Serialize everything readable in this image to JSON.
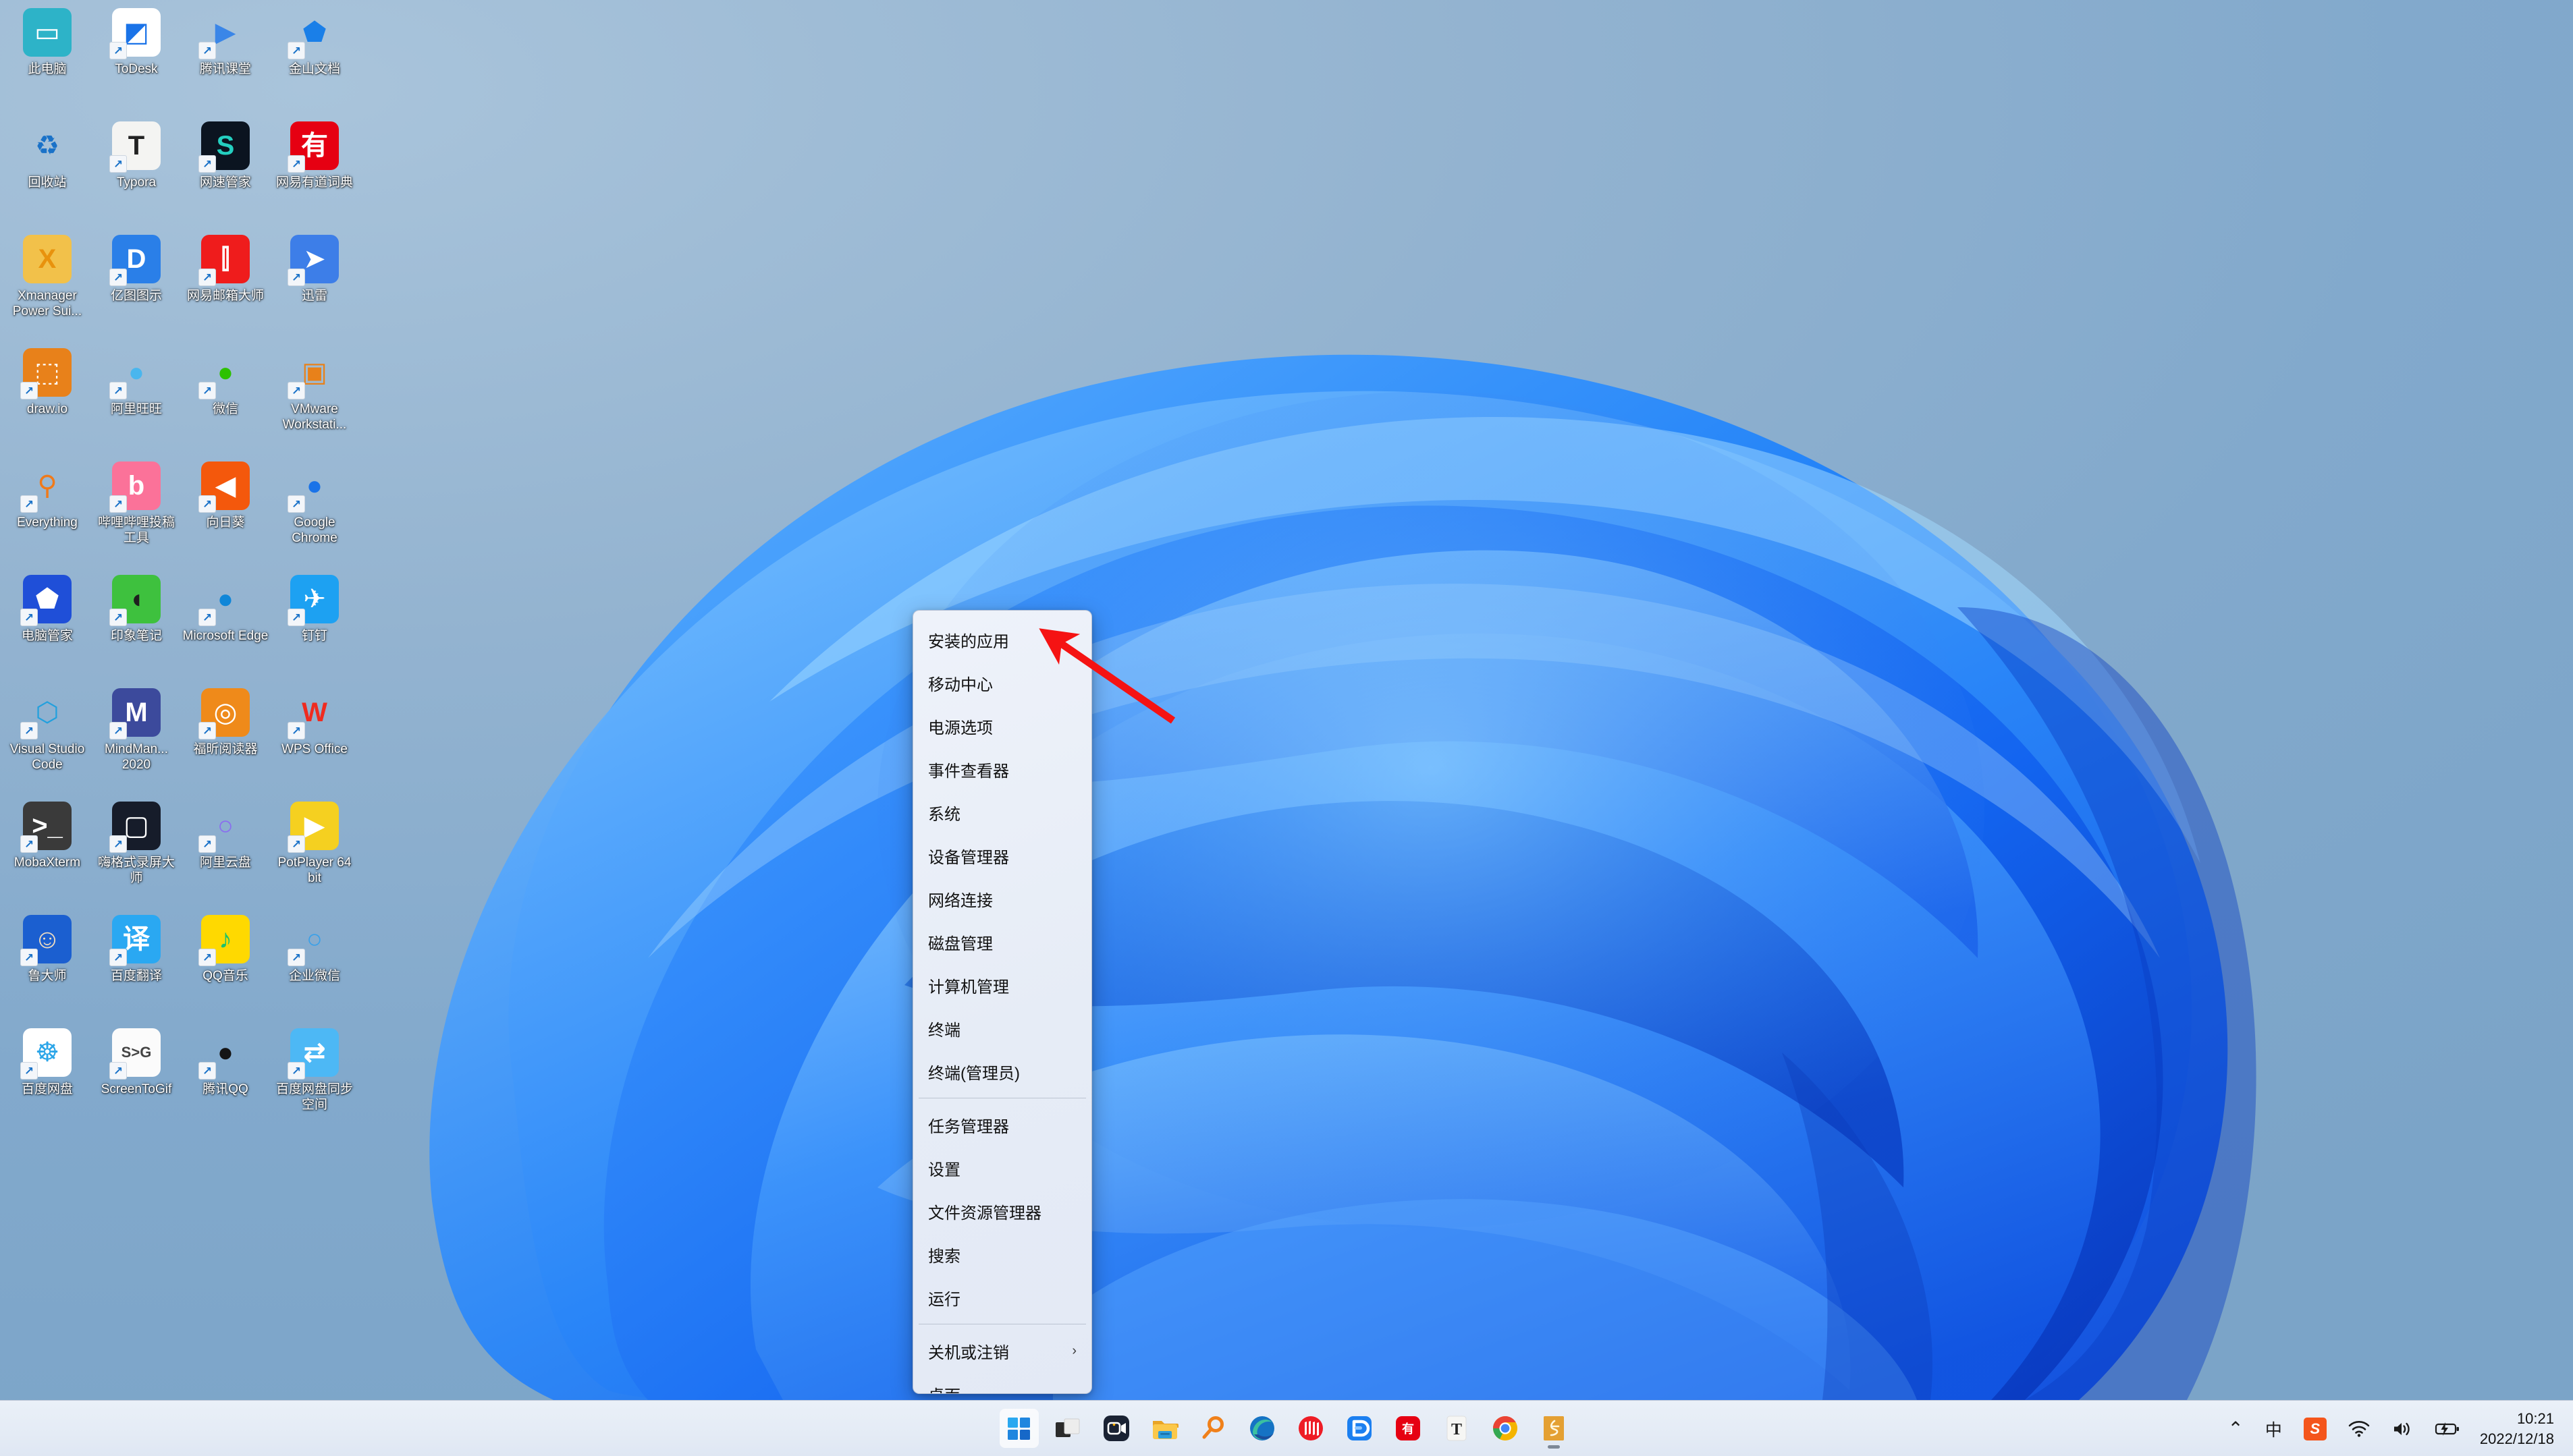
{
  "desktop": {
    "background_color": "#82aacd",
    "icons": [
      {
        "label": "此电脑",
        "icon": "computer-icon",
        "shortcut": false,
        "bg": "#2db3c8",
        "fg": "#ffffff",
        "glyph": "▭"
      },
      {
        "label": "ToDesk",
        "icon": "todesk-icon",
        "shortcut": true,
        "bg": "#ffffff",
        "fg": "#1a73e8",
        "glyph": "◩"
      },
      {
        "label": "腾讯课堂",
        "icon": "tencent-classroom-icon",
        "shortcut": true,
        "bg": "transparent",
        "fg": "#3a86e8",
        "glyph": "▶"
      },
      {
        "label": "金山文档",
        "icon": "kingsoft-docs-icon",
        "shortcut": true,
        "bg": "transparent",
        "fg": "#1a7fe8",
        "glyph": "⬟"
      },
      {
        "label": "回收站",
        "icon": "recycle-bin-icon",
        "shortcut": false,
        "bg": "transparent",
        "fg": "#1a72c8",
        "glyph": "♻"
      },
      {
        "label": "Typora",
        "icon": "typora-icon",
        "shortcut": true,
        "bg": "#f4f4f2",
        "fg": "#222222",
        "glyph": "T"
      },
      {
        "label": "网速管家",
        "icon": "netspeed-manager-icon",
        "shortcut": true,
        "bg": "#0b1420",
        "fg": "#24cfc0",
        "glyph": "S"
      },
      {
        "label": "网易有道词典",
        "icon": "youdao-dict-icon",
        "shortcut": true,
        "bg": "#e60012",
        "fg": "#ffffff",
        "glyph": "有"
      },
      {
        "label": "Xmanager Power Sui...",
        "icon": "xmanager-folder-icon",
        "shortcut": false,
        "bg": "#f2c14a",
        "fg": "#e8920d",
        "glyph": "X"
      },
      {
        "label": "亿图图示",
        "icon": "edraw-icon",
        "shortcut": true,
        "bg": "#2a7fe8",
        "fg": "#ffffff",
        "glyph": "D"
      },
      {
        "label": "网易邮箱大师",
        "icon": "netease-mail-icon",
        "shortcut": true,
        "bg": "#ef1c1c",
        "fg": "#ffffff",
        "glyph": "⫿"
      },
      {
        "label": "迅雷",
        "icon": "thunder-xunlei-icon",
        "shortcut": true,
        "bg": "#3d7ee8",
        "fg": "#ffffff",
        "glyph": "➤"
      },
      {
        "label": "draw.io",
        "icon": "drawio-icon",
        "shortcut": true,
        "bg": "#e8811a",
        "fg": "#ffffff",
        "glyph": "⬚"
      },
      {
        "label": "阿里旺旺",
        "icon": "aliwangwang-icon",
        "shortcut": true,
        "bg": "transparent",
        "fg": "#49b6ee",
        "glyph": "●"
      },
      {
        "label": "微信",
        "icon": "wechat-icon",
        "shortcut": true,
        "bg": "transparent",
        "fg": "#2dc100",
        "glyph": "●"
      },
      {
        "label": "VMware Workstati...",
        "icon": "vmware-icon",
        "shortcut": true,
        "bg": "transparent",
        "fg": "#e8811a",
        "glyph": "▣"
      },
      {
        "label": "Everything",
        "icon": "everything-search-icon",
        "shortcut": true,
        "bg": "transparent",
        "fg": "#f07a1a",
        "glyph": "⚲"
      },
      {
        "label": "哔哩哔哩投稿工具",
        "icon": "bilibili-upload-icon",
        "shortcut": true,
        "bg": "#fb7299",
        "fg": "#ffffff",
        "glyph": "b"
      },
      {
        "label": "向日葵",
        "icon": "sunlogin-icon",
        "shortcut": true,
        "bg": "#f4580c",
        "fg": "#ffffff",
        "glyph": "◀"
      },
      {
        "label": "Google Chrome",
        "icon": "chrome-icon",
        "shortcut": true,
        "bg": "transparent",
        "fg": "#1a73e8",
        "glyph": "●"
      },
      {
        "label": "电脑管家",
        "icon": "tencent-pc-manager-icon",
        "shortcut": true,
        "bg": "#1f4fd8",
        "fg": "#ffffff",
        "glyph": "⬟"
      },
      {
        "label": "印象笔记",
        "icon": "evernote-icon",
        "shortcut": true,
        "bg": "#3ec13e",
        "fg": "#1f1f1f",
        "glyph": "◖"
      },
      {
        "label": "Microsoft Edge",
        "icon": "edge-icon",
        "shortcut": true,
        "bg": "transparent",
        "fg": "#0f86d8",
        "glyph": "●"
      },
      {
        "label": "钉钉",
        "icon": "dingtalk-icon",
        "shortcut": true,
        "bg": "#1da1f2",
        "fg": "#ffffff",
        "glyph": "✈"
      },
      {
        "label": "Visual Studio Code",
        "icon": "vscode-icon",
        "shortcut": true,
        "bg": "transparent",
        "fg": "#22a0dd",
        "glyph": "⬡"
      },
      {
        "label": "MindMan... 2020",
        "icon": "mindmanager-icon",
        "shortcut": true,
        "bg": "#3c4a9c",
        "fg": "#ffffff",
        "glyph": "M"
      },
      {
        "label": "福昕阅读器",
        "icon": "foxit-reader-icon",
        "shortcut": true,
        "bg": "#ef8a1a",
        "fg": "#ffffff",
        "glyph": "◎"
      },
      {
        "label": "WPS Office",
        "icon": "wps-office-icon",
        "shortcut": true,
        "bg": "transparent",
        "fg": "#ef2b20",
        "glyph": "W"
      },
      {
        "label": "MobaXterm",
        "icon": "mobaxterm-icon",
        "shortcut": true,
        "bg": "#3a3a3a",
        "fg": "#ffffff",
        "glyph": ">_"
      },
      {
        "label": "嗨格式录屏大师",
        "icon": "haigeshi-recorder-icon",
        "shortcut": true,
        "bg": "#161c2a",
        "fg": "#ffffff",
        "glyph": "▢"
      },
      {
        "label": "阿里云盘",
        "icon": "aliyun-drive-icon",
        "shortcut": true,
        "bg": "transparent",
        "fg": "#8a6cf0",
        "glyph": "○"
      },
      {
        "label": "PotPlayer 64 bit",
        "icon": "potplayer-icon",
        "shortcut": true,
        "bg": "#f5d020",
        "fg": "#ffffff",
        "glyph": "▶"
      },
      {
        "label": "鲁大师",
        "icon": "ludashi-icon",
        "shortcut": true,
        "bg": "#1b5fd0",
        "fg": "#f0ddc0",
        "glyph": "☺"
      },
      {
        "label": "百度翻译",
        "icon": "baidu-translate-icon",
        "shortcut": true,
        "bg": "#2aa8f2",
        "fg": "#ffffff",
        "glyph": "译"
      },
      {
        "label": "QQ音乐",
        "icon": "qq-music-icon",
        "shortcut": true,
        "bg": "#ffd900",
        "fg": "#1ec26a",
        "glyph": "♪"
      },
      {
        "label": "企业微信",
        "icon": "wecom-icon",
        "shortcut": true,
        "bg": "transparent",
        "fg": "#3aa0e8",
        "glyph": "○"
      },
      {
        "label": "百度网盘",
        "icon": "baidu-netdisk-icon",
        "shortcut": true,
        "bg": "#ffffff",
        "fg": "#2ba5e8",
        "glyph": "☸"
      },
      {
        "label": "ScreenToGif",
        "icon": "screentogif-icon",
        "shortcut": true,
        "bg": "#fbfbfb",
        "fg": "#444444",
        "glyph": "S>G"
      },
      {
        "label": "腾讯QQ",
        "icon": "tencent-qq-icon",
        "shortcut": true,
        "bg": "transparent",
        "fg": "#151515",
        "glyph": "●"
      },
      {
        "label": "百度网盘同步空间",
        "icon": "baidu-netdisk-sync-icon",
        "shortcut": true,
        "bg": "#4db8f5",
        "fg": "#ffffff",
        "glyph": "⇄"
      }
    ]
  },
  "context_menu": {
    "groups": [
      {
        "items": [
          {
            "label": "安装的应用",
            "submenu": false
          },
          {
            "label": "移动中心",
            "submenu": false
          },
          {
            "label": "电源选项",
            "submenu": false
          },
          {
            "label": "事件查看器",
            "submenu": false
          },
          {
            "label": "系统",
            "submenu": false
          },
          {
            "label": "设备管理器",
            "submenu": false
          },
          {
            "label": "网络连接",
            "submenu": false
          },
          {
            "label": "磁盘管理",
            "submenu": false
          },
          {
            "label": "计算机管理",
            "submenu": false
          },
          {
            "label": "终端",
            "submenu": false
          },
          {
            "label": "终端(管理员)",
            "submenu": false
          }
        ]
      },
      {
        "items": [
          {
            "label": "任务管理器",
            "submenu": false
          },
          {
            "label": "设置",
            "submenu": false
          },
          {
            "label": "文件资源管理器",
            "submenu": false
          },
          {
            "label": "搜索",
            "submenu": false
          },
          {
            "label": "运行",
            "submenu": false
          }
        ]
      },
      {
        "items": [
          {
            "label": "关机或注销",
            "submenu": true,
            "submenu_glyph": "›"
          },
          {
            "label": "桌面",
            "submenu": false
          }
        ]
      }
    ]
  },
  "annotation": {
    "arrow_color": "#f51313",
    "points_to": "安装的应用"
  },
  "taskbar": {
    "background_color": "#e6ecf5",
    "buttons": [
      {
        "name": "start-button",
        "label": "开始",
        "icon": "windows-logo-icon",
        "active": true,
        "running": false
      },
      {
        "name": "task-view-button",
        "label": "任务视图",
        "icon": "task-view-icon",
        "active": false,
        "running": false
      },
      {
        "name": "screen-recorder-button",
        "label": "录屏",
        "icon": "screen-recorder-icon",
        "active": false,
        "running": false
      },
      {
        "name": "file-explorer-button",
        "label": "文件资源管理器",
        "icon": "folder-icon",
        "active": false,
        "running": false
      },
      {
        "name": "everything-button",
        "label": "Everything",
        "icon": "everything-search-icon",
        "active": false,
        "running": false
      },
      {
        "name": "edge-button",
        "label": "Microsoft Edge",
        "icon": "edge-icon",
        "active": false,
        "running": false
      },
      {
        "name": "netease-mail-button",
        "label": "网易邮箱大师",
        "icon": "netease-mail-icon",
        "active": false,
        "running": false
      },
      {
        "name": "edraw-button",
        "label": "亿图图示",
        "icon": "edraw-icon",
        "active": false,
        "running": false
      },
      {
        "name": "youdao-button",
        "label": "网易有道词典",
        "icon": "youdao-dict-icon",
        "active": false,
        "running": false
      },
      {
        "name": "typora-button",
        "label": "Typora",
        "icon": "typora-icon",
        "active": false,
        "running": false
      },
      {
        "name": "chrome-button",
        "label": "Google Chrome",
        "icon": "chrome-icon",
        "active": false,
        "running": false
      },
      {
        "name": "calligraphy-app-button",
        "label": "书法",
        "icon": "calligraphy-icon",
        "active": false,
        "running": true
      }
    ],
    "tray": {
      "overflow_glyph": "⌃",
      "ime_label": "中",
      "sogou_label": "S",
      "wifi_glyph": "◠",
      "volume_glyph": "◁",
      "battery_glyph": "▭",
      "time": "10:21",
      "date": "2022/12/18"
    }
  }
}
